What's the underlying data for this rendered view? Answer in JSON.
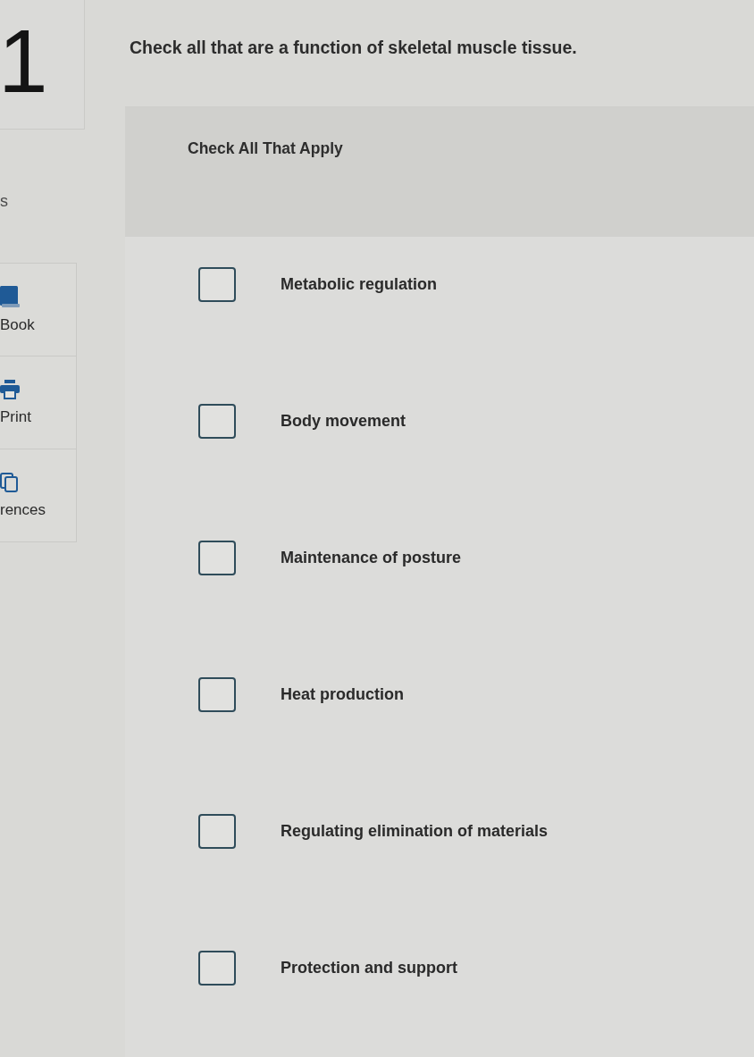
{
  "question": {
    "number": "1",
    "text": "Check all that are a function of skeletal muscle tissue."
  },
  "sidebar": {
    "points_fragment": "s",
    "tools": [
      {
        "kind": "book",
        "label": "Book"
      },
      {
        "kind": "print",
        "label": "Print"
      },
      {
        "kind": "references",
        "label": "rences"
      }
    ]
  },
  "answer_panel": {
    "instruction": "Check All That Apply",
    "options": [
      {
        "label": "Metabolic regulation",
        "checked": false
      },
      {
        "label": "Body movement",
        "checked": false
      },
      {
        "label": "Maintenance of posture",
        "checked": false
      },
      {
        "label": "Heat production",
        "checked": false
      },
      {
        "label": "Regulating elimination of materials",
        "checked": false
      },
      {
        "label": "Protection and support",
        "checked": false
      }
    ]
  }
}
